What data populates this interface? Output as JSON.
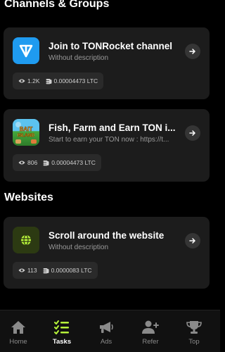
{
  "sections": {
    "channels_title": "Channels & Groups",
    "websites_title": "Websites"
  },
  "tasks": [
    {
      "title": "Join to TONRocket channel",
      "subtitle": "Without description",
      "views": "1.2K",
      "reward": "0.00004473 LTC",
      "icon": "ton-logo-icon"
    },
    {
      "title": "Fish, Farm and Earn TON i...",
      "subtitle": "Start to earn your TON now : https://t...",
      "views": "806",
      "reward": "0.00004473 LTC",
      "icon": "game-thumbnail-icon",
      "thumb_text_1": "BAIT",
      "thumb_text_2": "ISLAND"
    },
    {
      "title": "Scroll around the website",
      "subtitle": "Without description",
      "views": "113",
      "reward": "0.0000083 LTC",
      "icon": "globe-icon"
    }
  ],
  "nav": [
    {
      "label": "Home",
      "icon": "home-icon",
      "active": false
    },
    {
      "label": "Tasks",
      "icon": "tasks-icon",
      "active": true
    },
    {
      "label": "Ads",
      "icon": "megaphone-icon",
      "active": false
    },
    {
      "label": "Refer",
      "icon": "add-user-icon",
      "active": false
    },
    {
      "label": "Top",
      "icon": "trophy-icon",
      "active": false
    }
  ],
  "colors": {
    "accent": "#b6f23a",
    "ton_blue": "#1f9bf0",
    "card_bg": "#1c1c1c"
  }
}
